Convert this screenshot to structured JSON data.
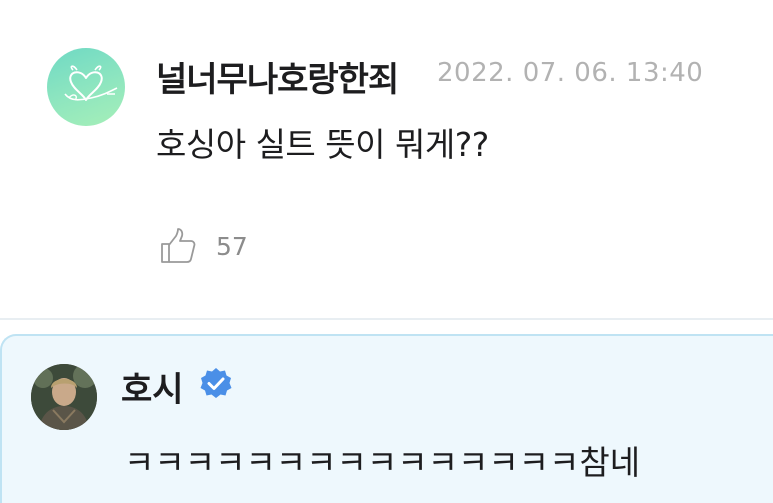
{
  "post": {
    "author": "널너무나호랑한죄",
    "timestamp": "2022. 07. 06. 13:40",
    "message": "호싱아 실트 뜻이 뭐게??",
    "like_count": "57",
    "avatar_icon": "heart-doodle-avatar"
  },
  "reply": {
    "author": "호시",
    "verified": true,
    "message": "ㅋㅋㅋㅋㅋㅋㅋㅋㅋㅋㅋㅋㅋㅋㅋ참네",
    "highlight_color": "#eef8fd",
    "verified_color": "#4a8fe7"
  }
}
